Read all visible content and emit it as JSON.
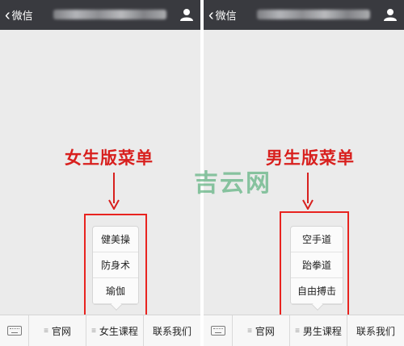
{
  "panels": [
    {
      "back_label": "微信",
      "annotation": "女生版菜单",
      "submenu": [
        "健美操",
        "防身术",
        "瑜伽"
      ],
      "tabs": [
        "官网",
        "女生课程",
        "联系我们"
      ]
    },
    {
      "back_label": "微信",
      "annotation": "男生版菜单",
      "submenu": [
        "空手道",
        "跆拳道",
        "自由搏击"
      ],
      "tabs": [
        "官网",
        "男生课程",
        "联系我们"
      ]
    }
  ],
  "watermark": "吉云网",
  "colors": {
    "header": "#393a3f",
    "annotation": "#d8201e",
    "highlight_box": "#e8231f",
    "watermark": "#44a86b"
  },
  "icons": {
    "back": "chevron-left-icon",
    "profile": "person-icon",
    "keyboard": "keyboard-icon",
    "menu": "menu-lines-icon"
  }
}
